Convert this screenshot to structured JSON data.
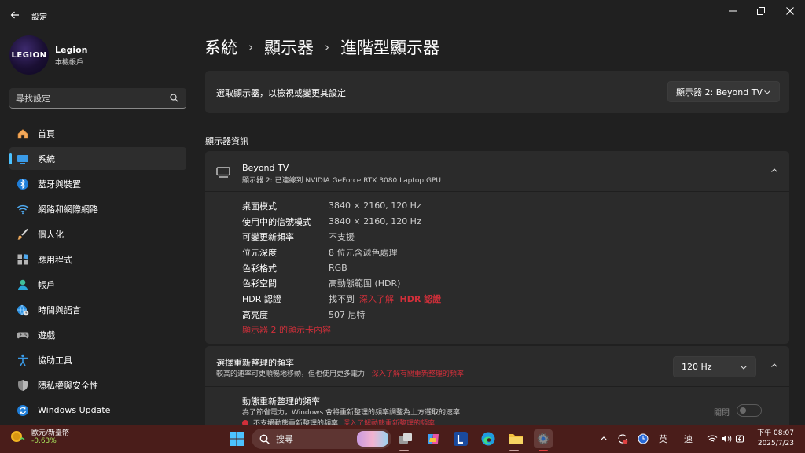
{
  "window": {
    "app_title": "設定",
    "controls": {
      "minimize": "–",
      "maximize": "❐",
      "close": "✕"
    }
  },
  "profile": {
    "avatar_text": "LEGION",
    "name": "Legion",
    "subtitle": "本機帳戶"
  },
  "search": {
    "placeholder": "尋找設定"
  },
  "sidebar": {
    "items": [
      {
        "label": "首頁",
        "icon": "home-icon",
        "active": false
      },
      {
        "label": "系統",
        "icon": "system-display-icon",
        "active": true
      },
      {
        "label": "藍牙與裝置",
        "icon": "bluetooth-icon",
        "active": false
      },
      {
        "label": "網路和網際網路",
        "icon": "wifi-icon",
        "active": false
      },
      {
        "label": "個人化",
        "icon": "paintbrush-icon",
        "active": false
      },
      {
        "label": "應用程式",
        "icon": "apps-icon",
        "active": false
      },
      {
        "label": "帳戶",
        "icon": "account-icon",
        "active": false
      },
      {
        "label": "時間與語言",
        "icon": "globe-clock-icon",
        "active": false
      },
      {
        "label": "遊戲",
        "icon": "gamepad-icon",
        "active": false
      },
      {
        "label": "協助工具",
        "icon": "accessibility-icon",
        "active": false
      },
      {
        "label": "隱私權與安全性",
        "icon": "shield-icon",
        "active": false
      },
      {
        "label": "Windows Update",
        "icon": "windows-update-icon",
        "active": false
      }
    ]
  },
  "breadcrumb": [
    "系統",
    "顯示器",
    "進階型顯示器"
  ],
  "display_select": {
    "label": "選取顯示器，以檢視或變更其設定",
    "value": "顯示器 2: Beyond TV"
  },
  "section_title": "顯示器資訊",
  "info": {
    "name": "Beyond TV",
    "subtitle": "顯示器 2: 已連線到 NVIDIA GeForce RTX 3080 Laptop GPU",
    "rows": [
      {
        "key": "桌面模式",
        "value": "3840 × 2160, 120 Hz"
      },
      {
        "key": "使用中的信號模式",
        "value": "3840 × 2160, 120 Hz"
      },
      {
        "key": "可變更新頻率",
        "value": "不支援"
      },
      {
        "key": "位元深度",
        "value": "8 位元含遞色處理"
      },
      {
        "key": "色彩格式",
        "value": "RGB"
      },
      {
        "key": "色彩空間",
        "value": "高動態範圍 (HDR)"
      },
      {
        "key": "HDR 認證",
        "value": "找不到",
        "link_prefix": "深入了解",
        "link_bold": "HDR 認證"
      },
      {
        "key": "高亮度",
        "value": "507 尼特"
      }
    ],
    "adapter_link": "顯示器 2 的顯示卡內容"
  },
  "refresh": {
    "title": "選擇重新整理的頻率",
    "subtitle": "較高的速率可更順暢地移動，但也使用更多電力",
    "subtitle_link": "深入了解有關重新整理的頻率",
    "value": "120 Hz",
    "dynamic_title": "動態重新整理的頻率",
    "dynamic_subtitle": "為了節省電力，Windows 會將重新整理的頻率調整為上方選取的速率",
    "dynamic_warning": "不支援動態重新整理的頻率",
    "dynamic_warning_link": "深入了解動態重新整理的頻率",
    "toggle_label": "關閉",
    "toggle_on": false
  },
  "taskbar": {
    "widget_line1": "歐元/新臺幣",
    "widget_line2": "-0.63%",
    "search_label": "搜尋",
    "ime_mode": "英",
    "ime_speed": "速",
    "clock_line1": "下午 08:07",
    "clock_line2": "2025/7/23"
  },
  "colors": {
    "background": "#202020",
    "card": "#2b2b2b",
    "accent": "#4cc2ff",
    "link": "#d12f3a",
    "taskbar": "#4a1d1a"
  }
}
